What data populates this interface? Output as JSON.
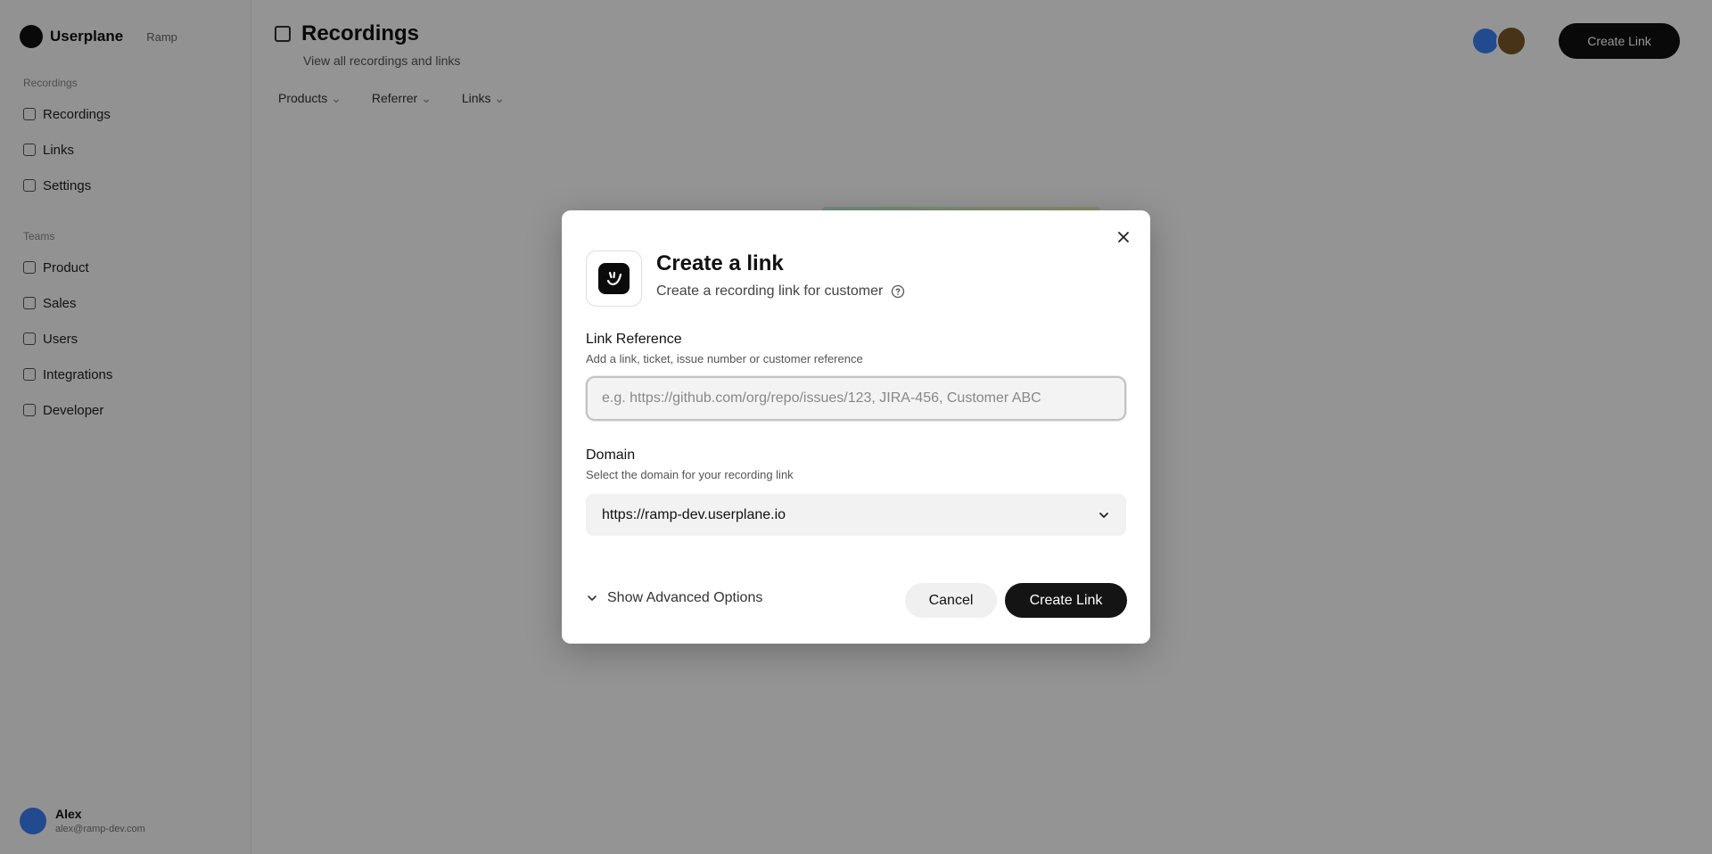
{
  "sidebar": {
    "brand": "Userplane",
    "workspace_switch": "Ramp",
    "section_main": "Recordings",
    "items_main": [
      {
        "label": "Recordings"
      },
      {
        "label": "Links"
      },
      {
        "label": "Settings"
      }
    ],
    "section_more": "Teams",
    "items_more": [
      {
        "label": "Product"
      },
      {
        "label": "Sales"
      },
      {
        "label": "Users"
      },
      {
        "label": "Integrations"
      },
      {
        "label": "Developer"
      }
    ],
    "user": {
      "name": "Alex",
      "email": "alex@ramp-dev.com"
    }
  },
  "main": {
    "title": "Recordings",
    "subtitle": "View all recordings and links",
    "filters": [
      "Products",
      "Referrer",
      "Links"
    ],
    "cta": "Create Link"
  },
  "modal": {
    "title": "Create a link",
    "subtitle": "Create a recording link for customer",
    "link_reference": {
      "label": "Link Reference",
      "help": "Add a link, ticket, issue number or customer reference",
      "placeholder": "e.g. https://github.com/org/repo/issues/123, JIRA-456, Customer ABC",
      "value": ""
    },
    "domain": {
      "label": "Domain",
      "help": "Select the domain for your recording link",
      "selected": "https://ramp-dev.userplane.io"
    },
    "advanced_toggle": "Show Advanced Options",
    "cancel_label": "Cancel",
    "create_label": "Create Link"
  },
  "colors": {
    "overlay": "#000000",
    "primary_button": "#141414",
    "secondary_button": "#f0f0f0"
  }
}
